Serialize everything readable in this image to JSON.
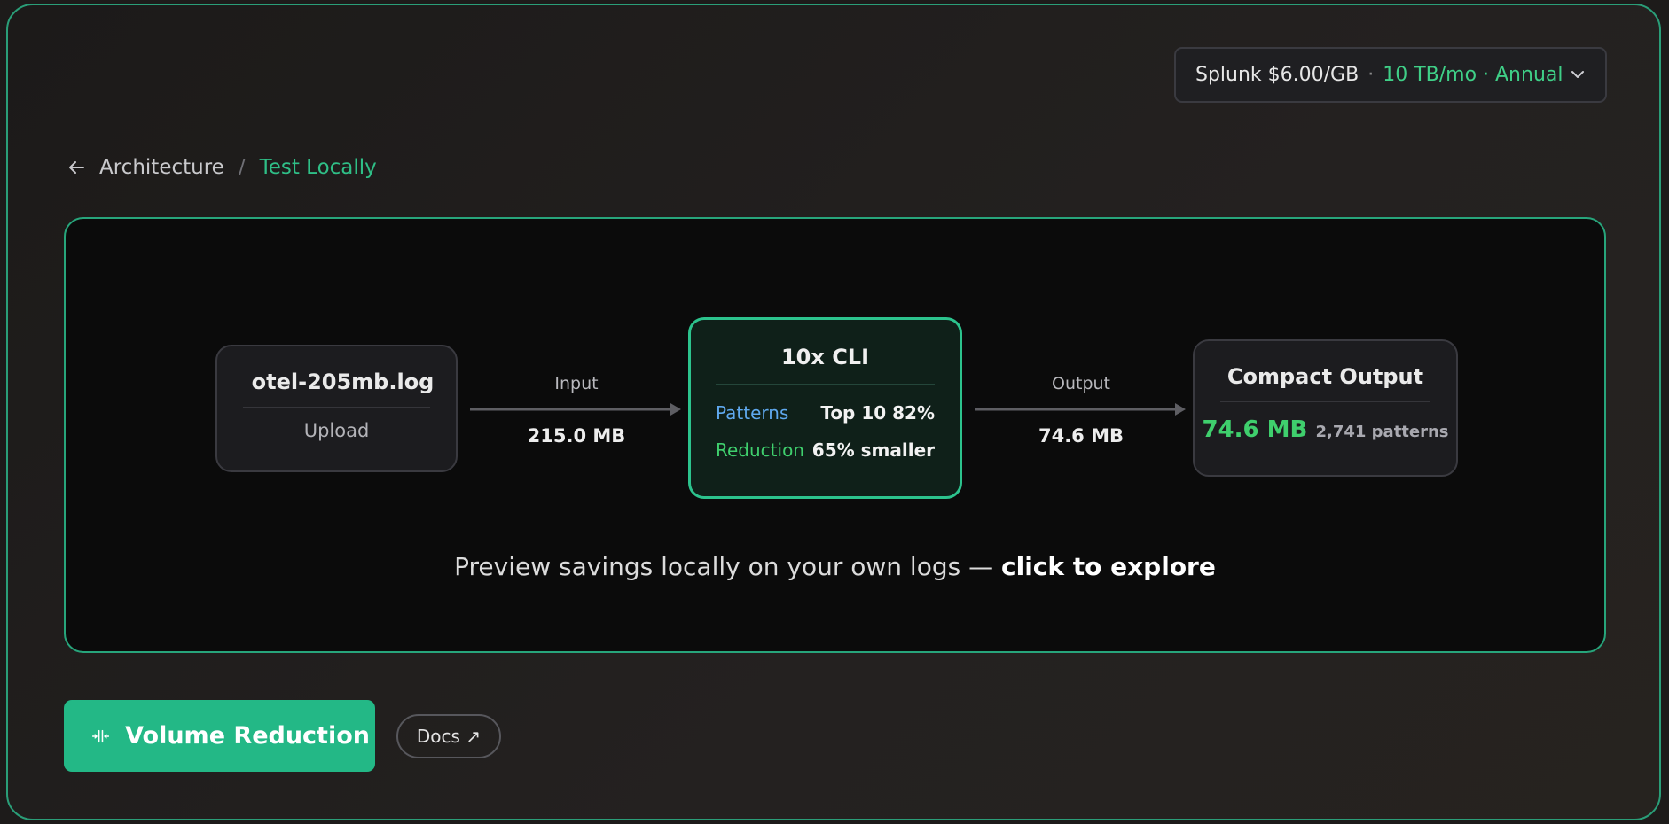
{
  "pricing": {
    "vendor": "Splunk $6.00/GB",
    "separator": "·",
    "plan": "10 TB/mo · Annual"
  },
  "breadcrumb": {
    "parent": "Architecture",
    "separator": "/",
    "current": "Test Locally"
  },
  "pipeline": {
    "input_node": {
      "filename": "otel-205mb.log",
      "action": "Upload",
      "icon": "upload-icon"
    },
    "input_edge": {
      "label": "Input",
      "value": "215.0 MB"
    },
    "cli_node": {
      "title": "10x CLI",
      "patterns_label": "Patterns",
      "patterns_value": "Top 10 82%",
      "reduction_label": "Reduction",
      "reduction_value": "65% smaller"
    },
    "output_edge": {
      "label": "Output",
      "value": "74.6 MB"
    },
    "output_node": {
      "title": "Compact Output",
      "size": "74.6 MB",
      "patterns": "2,741 patterns"
    }
  },
  "cta": {
    "text": "Preview savings locally on your own logs — ",
    "emphasis": "click to explore"
  },
  "actions": {
    "primary_label": "Volume Reduction",
    "primary_icon": "compress-icon",
    "docs_label": "Docs ↗"
  },
  "colors": {
    "accent": "#23b886",
    "border_accent": "#27a57b",
    "positive": "#3fcf6d",
    "patterns_blue": "#5fa8ee"
  }
}
